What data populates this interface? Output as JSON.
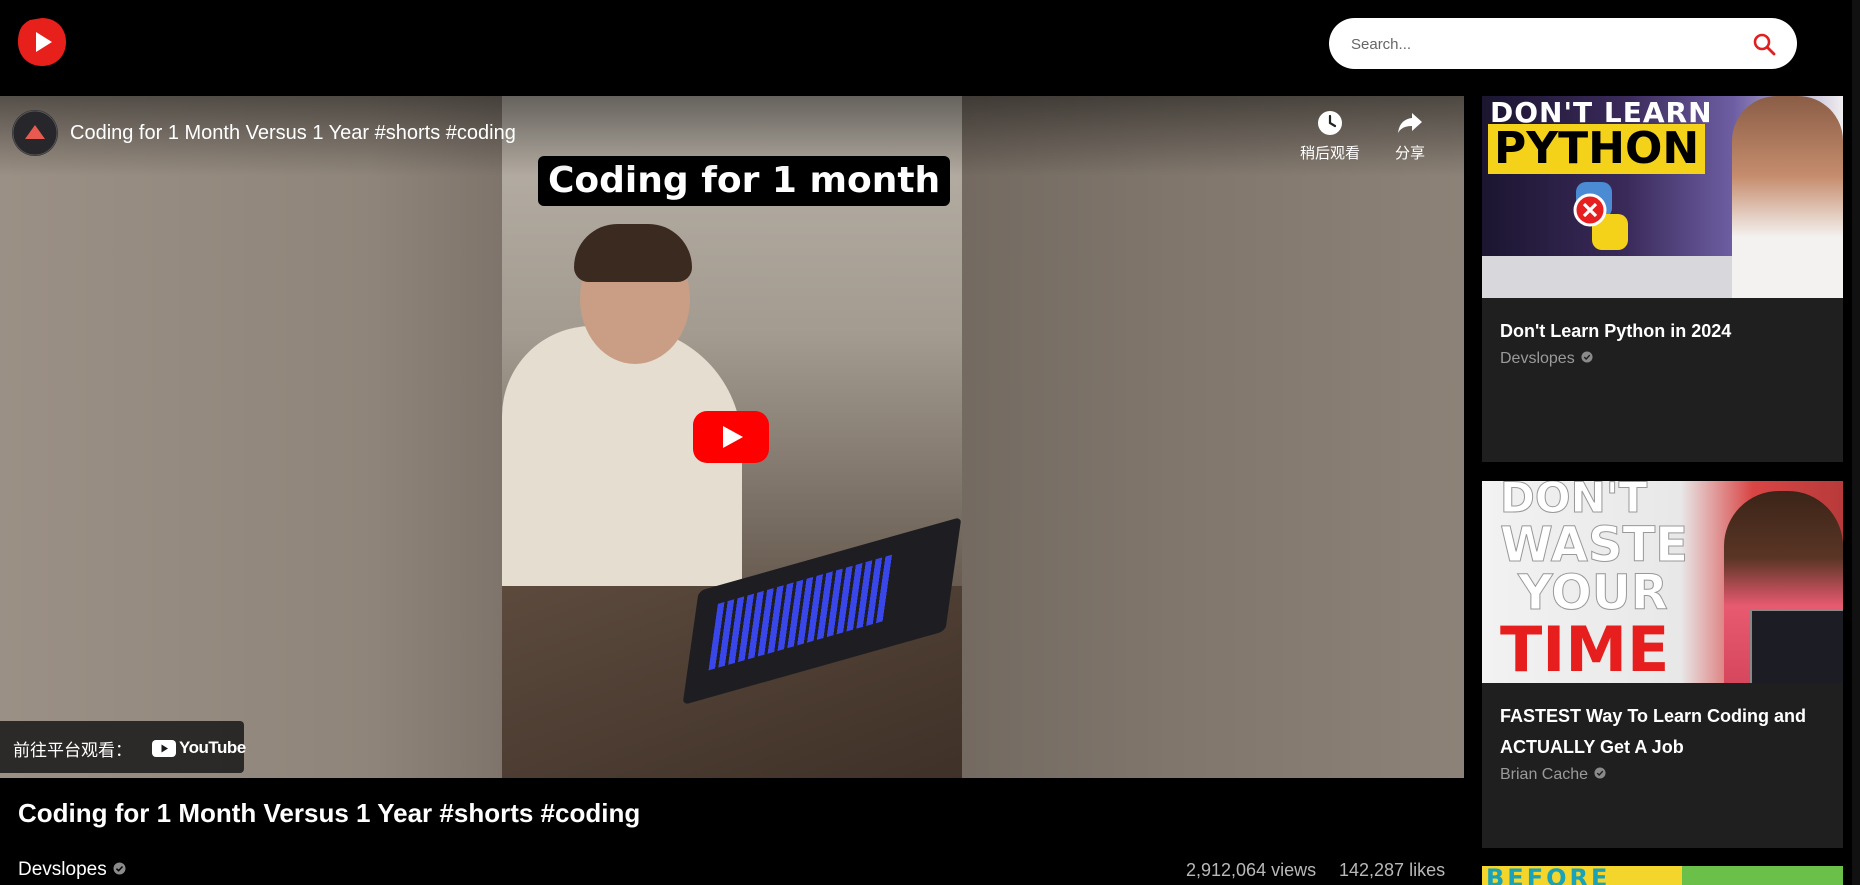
{
  "header": {
    "logo_icon": "play-logo-icon",
    "search": {
      "placeholder": "Search...",
      "value": "",
      "icon": "search-icon"
    }
  },
  "player": {
    "title": "Coding for 1 Month Versus 1 Year #shorts #coding",
    "overlay_caption": "Coding for 1 month",
    "actions": [
      {
        "label": "稍后观看",
        "icon": "clock-icon"
      },
      {
        "label": "分享",
        "icon": "share-icon"
      }
    ],
    "watch_on": {
      "label": "前往平台观看：",
      "brand": "YouTube"
    }
  },
  "video": {
    "title": "Coding for 1 Month Versus 1 Year #shorts #coding",
    "channel": "Devslopes",
    "views": "2,912,064 views",
    "likes": "142,287 likes"
  },
  "sidebar": {
    "items": [
      {
        "title": "Don't Learn Python in 2024",
        "channel": "Devslopes",
        "thumb_text": [
          "DON'T LEARN",
          "PYTHON"
        ]
      },
      {
        "title": "FASTEST Way To Learn Coding and ACTUALLY Get A Job",
        "channel": "Brian Cache",
        "thumb_text": [
          "DON'T",
          "WASTE",
          "YOUR",
          "TIME"
        ]
      },
      {
        "thumb_text": [
          "BEFORE"
        ]
      }
    ]
  },
  "colors": {
    "accent": "#ff0000",
    "background": "#000000",
    "card": "#1f1f1f",
    "muted": "#9a9a9a"
  }
}
